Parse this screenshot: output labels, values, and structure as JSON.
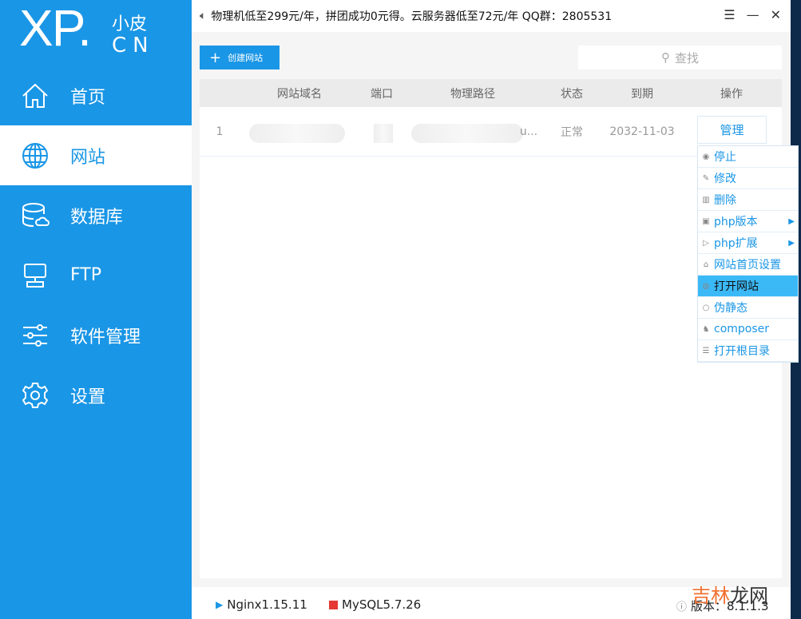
{
  "logo": {
    "main": "XP.",
    "sub1": "小皮",
    "sub2": "CN"
  },
  "nav": [
    {
      "label": "首页",
      "icon": "home-icon"
    },
    {
      "label": "网站",
      "icon": "globe-icon"
    },
    {
      "label": "数据库",
      "icon": "database-icon"
    },
    {
      "label": "FTP",
      "icon": "monitor-icon"
    },
    {
      "label": "软件管理",
      "icon": "sliders-icon"
    },
    {
      "label": "设置",
      "icon": "gear-icon"
    }
  ],
  "topbar": {
    "notice": "物理机低至299元/年，拼团成功0元得。云服务器低至72元/年  QQ群：2805531"
  },
  "toolbar": {
    "create_label": "创建网站",
    "search_placeholder": "查找"
  },
  "table": {
    "headers": [
      "网站域名",
      "端口",
      "物理路径",
      "状态",
      "到期",
      "操作"
    ],
    "rows": [
      {
        "index": "1",
        "path_tail": "u...",
        "status": "正常",
        "expiry": "2032-11-03",
        "action": "管理"
      }
    ]
  },
  "menu": [
    {
      "label": "停止",
      "icon": "stop-icon"
    },
    {
      "label": "修改",
      "icon": "pencil-icon"
    },
    {
      "label": "删除",
      "icon": "trash-icon"
    },
    {
      "label": "php版本",
      "icon": "php-icon",
      "submenu": true
    },
    {
      "label": "php扩展",
      "icon": "extension-icon",
      "submenu": true
    },
    {
      "label": "网站首页设置",
      "icon": "home-icon"
    },
    {
      "label": "打开网站",
      "icon": "globe-icon",
      "highlighted": true
    },
    {
      "label": "伪静态",
      "icon": "ring-icon"
    },
    {
      "label": "composer",
      "icon": "composer-icon"
    },
    {
      "label": "打开根目录",
      "icon": "list-icon"
    }
  ],
  "footer": {
    "nginx": "Nginx1.15.11",
    "mysql": "MySQL5.7.26",
    "version": "版本：8.1.1.3"
  },
  "watermark": {
    "a": "吉林",
    "b": "龙网"
  },
  "colors": {
    "accent": "#1a96e6",
    "highlight": "#3bb9f7",
    "mysql": "#e53935"
  }
}
